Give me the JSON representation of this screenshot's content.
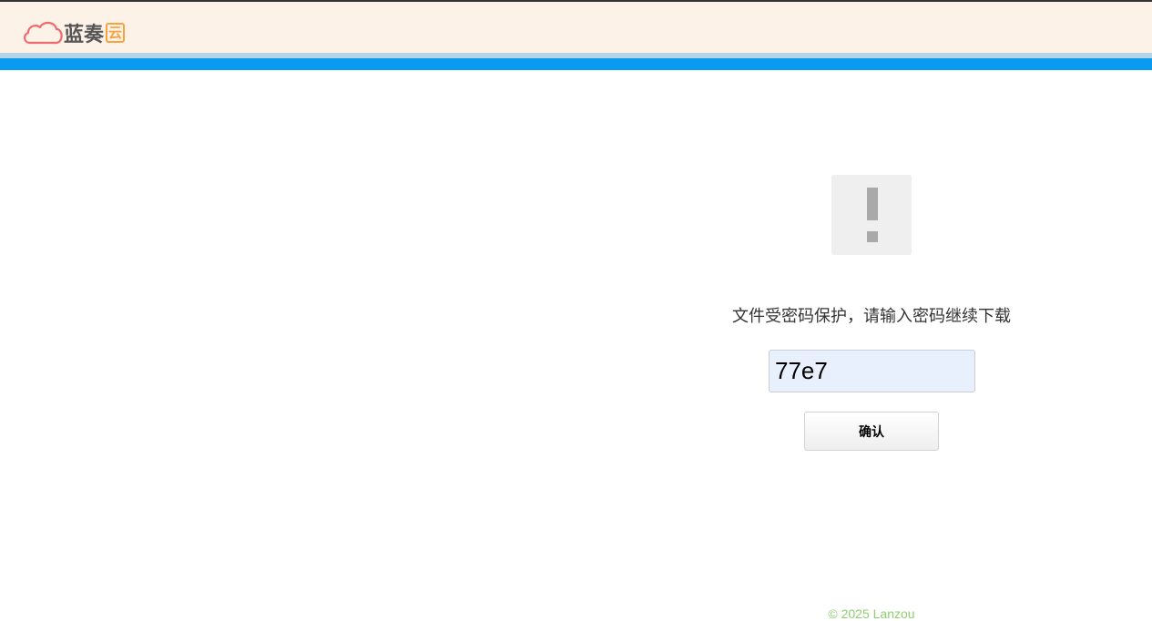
{
  "header": {
    "logo_text": "蓝奏",
    "logo_badge": "云",
    "logo_icon": "cloud-icon",
    "colors": {
      "header_bg": "#fdf2e8",
      "accent_stripe": "#0a9bf0",
      "logo_cloud": "#ef6b6b",
      "logo_badge": "#f6a23f"
    }
  },
  "main": {
    "warning_icon": "exclamation-icon",
    "prompt": "文件受密码保护，请输入密码继续下载",
    "password_value": "77e7",
    "confirm_label": "确认"
  },
  "footer": {
    "copyright": "© 2025 Lanzou"
  }
}
